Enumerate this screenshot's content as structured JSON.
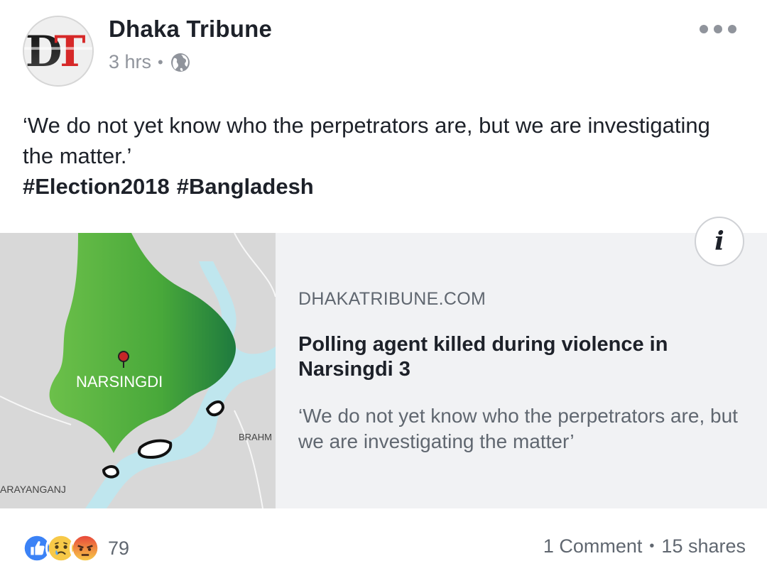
{
  "post": {
    "page_name": "Dhaka Tribune",
    "timestamp": "3 hrs",
    "separator": "•",
    "privacy_icon": "globe-icon",
    "avatar_logo": "DT",
    "more_icon": "more-options-icon",
    "text_line": "‘We do not yet know who the perpetrators are, but we are investigating the matter.’",
    "hashtags": [
      "#Election2018",
      "#Bangladesh"
    ]
  },
  "link_preview": {
    "map_labels": {
      "district": "NARSINGDI",
      "river": "BRAHM",
      "neighbor": "ARAYANGANJ"
    },
    "info_icon": "i",
    "domain": "DHAKATRIBUNE.COM",
    "headline": "Polling agent killed during violence in Narsingdi 3",
    "description": "‘We do not yet know who the perpetrators are, but we are investigating the matter’"
  },
  "footer": {
    "reaction_icons": [
      "like-icon",
      "sad-icon",
      "angry-icon"
    ],
    "reaction_count": "79",
    "comments": "1 Comment",
    "separator": "•",
    "shares": "15 shares"
  },
  "colors": {
    "like": "#3b82f6",
    "text": "#1d2129",
    "muted": "#606770",
    "preview_bg": "#f1f2f4",
    "map_green": "#4caf3a"
  }
}
